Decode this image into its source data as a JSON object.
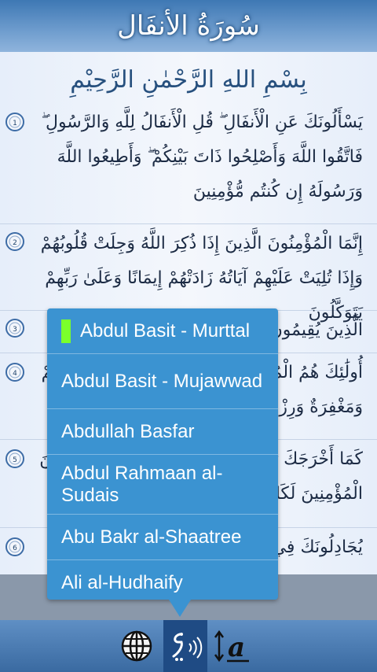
{
  "header": {
    "title": "سُورَةُ الأنفَال"
  },
  "bismillah": "بِسْمِ اللهِ الرَّحْمٰنِ الرَّحِيْمِ",
  "ayahs": [
    {
      "number": "1",
      "text": "يَسْأَلُونَكَ عَنِ الْأَنفَالِ ۖ قُلِ الْأَنفَالُ لِلَّهِ وَالرَّسُولِ ۖ فَاتَّقُوا اللَّهَ وَأَصْلِحُوا ذَاتَ بَيْنِكُمْ ۖ وَأَطِيعُوا اللَّهَ وَرَسُولَهُ إِن كُنتُم مُّؤْمِنِينَ"
    },
    {
      "number": "2",
      "text": "إِنَّمَا الْمُؤْمِنُونَ الَّذِينَ إِذَا ذُكِرَ اللَّهُ وَجِلَتْ قُلُوبُهُمْ وَإِذَا تُلِيَتْ عَلَيْهِمْ آيَاتُهُ زَادَتْهُمْ إِيمَانًا وَعَلَىٰ رَبِّهِمْ يَتَوَكَّلُونَ"
    },
    {
      "number": "3",
      "text": "الَّذِينَ يُقِيمُونَ الصَّلَاةَ وَمِمَّا رَزَقْنَاهُمْ يُنفِقُونَ"
    },
    {
      "number": "4",
      "text": "أُولَٰئِكَ هُمُ الْمُؤْمِنُونَ حَقًّا ۚ لَّهُمْ دَرَجَاتٌ عِندَ رَبِّهِمْ وَمَغْفِرَةٌ وَرِزْقٌ كَرِيمٌ"
    },
    {
      "number": "5",
      "text": "كَمَا أَخْرَجَكَ رَبُّكَ مِن بَيْتِكَ بِالْحَقِّ وَإِنَّ فَرِيقًا مِّنَ الْمُؤْمِنِينَ لَكَارِهُونَ"
    },
    {
      "number": "6",
      "text": "يُجَادِلُونَكَ فِي الْحَقِّ بَعْدَمَا تَبَيَّنَ"
    }
  ],
  "reciter_menu": {
    "items": [
      "Abdul Basit - Murttal",
      "Abdul Basit - Mujawwad",
      "Abdullah Basfar",
      "Abdul Rahmaan al-Sudais",
      "Abu Bakr al-Shaatree",
      "Ali al-Hudhaify"
    ],
    "selected": "Abdul Basit - Murttal"
  },
  "toolbar": {
    "icons": [
      "globe-icon",
      "reciter-audio-icon",
      "font-size-icon"
    ],
    "active": "reciter-audio-icon",
    "font_glyph": "a"
  },
  "colors": {
    "accent": "#3b93d1",
    "selected_marker": "#7bff2b",
    "toolbar": "#4a7db7"
  }
}
